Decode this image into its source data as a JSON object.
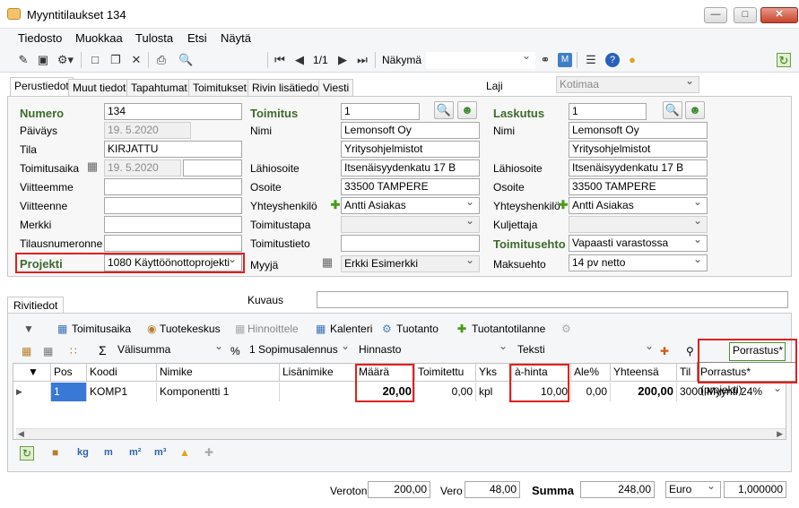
{
  "window": {
    "title": "Myyntitilaukset 134",
    "minimize": "—",
    "maximize": "□",
    "close": "✕"
  },
  "menu": [
    "Tiedosto",
    "Muokkaa",
    "Tulosta",
    "Etsi",
    "Näytä"
  ],
  "toolbar": {
    "page": "1/1",
    "view_label": "Näkymä",
    "view_value": ""
  },
  "tabs": [
    "Perustiedot",
    "Muut tiedot",
    "Tapahtumat",
    "Toimitukset",
    "Rivin lisätiedot",
    "Viesti"
  ],
  "laji": {
    "label": "Laji",
    "value": "Kotimaa"
  },
  "left": {
    "numero": {
      "label": "Numero",
      "value": "134"
    },
    "paivays": {
      "label": "Päiväys",
      "value": "19.  5.2020"
    },
    "tila": {
      "label": "Tila",
      "value": "KIRJATTU"
    },
    "toimitusaika": {
      "label": "Toimitusaika",
      "value": "19.  5.2020"
    },
    "viitteemme": {
      "label": "Viitteemme",
      "value": ""
    },
    "viitteenne": {
      "label": "Viitteenne",
      "value": ""
    },
    "merkki": {
      "label": "Merkki",
      "value": ""
    },
    "tilausnumero": {
      "label": "Tilausnumeronne",
      "value": ""
    },
    "projekti": {
      "label": "Projekti",
      "value": "1080 Käyttöönottoprojekti"
    }
  },
  "middle": {
    "toimitus": {
      "label": "Toimitus",
      "value": "1"
    },
    "nimi": {
      "label": "Nimi",
      "value": "Lemonsoft Oy",
      "value2": "Yritysohjelmistot"
    },
    "lahiosoite": {
      "label": "Lähiosoite",
      "value": "Itsenäisyydenkatu 17 B"
    },
    "osoite": {
      "label": "Osoite",
      "value": "33500  TAMPERE"
    },
    "yhteyshenkilo": {
      "label": "Yhteyshenkilö",
      "value": "Antti Asiakas"
    },
    "toimitustapa": {
      "label": "Toimitustapa",
      "value": ""
    },
    "toimitustieto": {
      "label": "Toimitustieto",
      "value": ""
    },
    "myyja": {
      "label": "Myyjä",
      "value": "Erkki Esimerkki"
    }
  },
  "right": {
    "laskutus": {
      "label": "Laskutus",
      "value": "1"
    },
    "nimi": {
      "label": "Nimi",
      "value": "Lemonsoft Oy",
      "value2": "Yritysohjelmistot"
    },
    "lahiosoite": {
      "label": "Lähiosoite",
      "value": "Itsenäisyydenkatu 17 B"
    },
    "osoite": {
      "label": "Osoite",
      "value": "33500  TAMPERE"
    },
    "yhteyshenkilo": {
      "label": "Yhteyshenkilö",
      "value": "Antti Asiakas"
    },
    "kuljettaja": {
      "label": "Kuljettaja",
      "value": ""
    },
    "toimitusehto": {
      "label": "Toimitusehto",
      "value": "Vapaasti varastossa"
    },
    "maksuehto": {
      "label": "Maksuehto",
      "value": "14 pv netto"
    }
  },
  "rivitiedot": {
    "tab": "Rivitiedot",
    "kuvaus_label": "Kuvaus",
    "kuvaus_value": ""
  },
  "rowtoolbar": [
    "Toimitusaika",
    "Tuotekeskus",
    "Hinnoittele",
    "Kalenteri",
    "Tuotanto",
    "Tuotantotilanne"
  ],
  "filterbar": {
    "valisumma": "Välisumma",
    "percent": "%",
    "sopimus": "1 Sopimusalennus",
    "hinnasto": "Hinnasto",
    "teksti": "Teksti",
    "search": "Porrastus*",
    "suggestion": "Porrastus* (projekti)"
  },
  "grid": {
    "headers": [
      "Pos",
      "Koodi",
      "Nimike",
      "Lisänimike",
      "Määrä",
      "Toimitettu",
      "Yks",
      "à-hinta",
      "Ale%",
      "Yhteensä",
      "Til"
    ],
    "rows": [
      {
        "pos": "1",
        "koodi": "KOMP1",
        "nimike": "Komponentti 1",
        "lisanimike": "",
        "maara": "20,00",
        "toimitettu": "0,00",
        "yks": "kpl",
        "ahinta": "10,00",
        "ale": "0,00",
        "yhteensa": "200,00",
        "til": "3000 Myynti 24%"
      }
    ]
  },
  "bottomtools": [
    "kg",
    "m",
    "m²",
    "m³"
  ],
  "totals": {
    "veroton_label": "Veroton",
    "veroton": "200,00",
    "vero_label": "Vero",
    "vero": "48,00",
    "summa_label": "Summa",
    "summa": "248,00",
    "currency": "Euro",
    "rate": "1,000000"
  }
}
